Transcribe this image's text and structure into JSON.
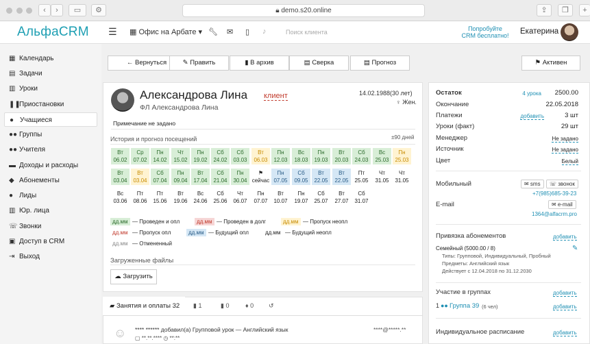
{
  "browser": {
    "url": "demo.s20.online",
    "back": "‹",
    "fwd": "›"
  },
  "topbar": {
    "logo": "АльфаCRM",
    "branch": "Офис на Арбате",
    "search_placeholder": "Поиск клиента",
    "promo": "Попробуйте CRM бесплатно!",
    "user": "Екатерина"
  },
  "sidebar": {
    "items": [
      {
        "icon": "calendar-icon",
        "glyph": "▦",
        "label": "Календарь"
      },
      {
        "icon": "tasks-icon",
        "glyph": "▤",
        "label": "Задачи"
      },
      {
        "icon": "lessons-icon",
        "glyph": "▥",
        "label": "Уроки"
      },
      {
        "icon": "pause-icon",
        "glyph": "❚❚",
        "label": "Приостановки"
      },
      {
        "icon": "user-icon",
        "glyph": "●",
        "label": "Учащиеся"
      },
      {
        "icon": "groups-icon",
        "glyph": "●●",
        "label": "Группы"
      },
      {
        "icon": "teachers-icon",
        "glyph": "●●",
        "label": "Учителя"
      },
      {
        "icon": "money-icon",
        "glyph": "▬",
        "label": "Доходы и расходы"
      },
      {
        "icon": "subscription-icon",
        "glyph": "◆",
        "label": "Абонементы"
      },
      {
        "icon": "leads-icon",
        "glyph": "●",
        "label": "Лиды"
      },
      {
        "icon": "company-icon",
        "glyph": "▥",
        "label": "Юр. лица"
      },
      {
        "icon": "phone-icon",
        "glyph": "☏",
        "label": "Звонки"
      },
      {
        "icon": "lock-icon",
        "glyph": "▣",
        "label": "Доступ в CRM"
      },
      {
        "icon": "exit-icon",
        "glyph": "⇥",
        "label": "Выход"
      }
    ]
  },
  "toolbar": {
    "back": "← Вернуться",
    "edit": "✎ Править",
    "archive": "▮ В архив",
    "reconcile": "▤ Сверка",
    "forecast": "▤ Прогноз",
    "status": "⚑ Активен"
  },
  "client": {
    "name": "Александрова Лина",
    "tag": "клиент",
    "subtitle": "ФЛ Александрова Лина",
    "birthdate": "14.02.1988(30 лет)",
    "gender": "♀ Жен.",
    "note": "Примечание не задано"
  },
  "history": {
    "title": "История и прогноз посещений",
    "range": "±90 дней",
    "rows": [
      [
        {
          "d": "Вт",
          "v": "06.02",
          "c": "g"
        },
        {
          "d": "Ср",
          "v": "07.02",
          "c": "g"
        },
        {
          "d": "Пн",
          "v": "14.02",
          "c": "g"
        },
        {
          "d": "Чт",
          "v": "15.02",
          "c": "g"
        },
        {
          "d": "Пн",
          "v": "19.02",
          "c": "g"
        },
        {
          "d": "Сб",
          "v": "24.02",
          "c": "g"
        },
        {
          "d": "Сб",
          "v": "03.03",
          "c": "g"
        },
        {
          "d": "Вт",
          "v": "06.03",
          "c": "y"
        },
        {
          "d": "Пн",
          "v": "12.03",
          "c": "g"
        },
        {
          "d": "Вс",
          "v": "18.03",
          "c": "g"
        },
        {
          "d": "Пн",
          "v": "19.03",
          "c": "g"
        },
        {
          "d": "Вт",
          "v": "20.03",
          "c": "g"
        },
        {
          "d": "Сб",
          "v": "24.03",
          "c": "g"
        },
        {
          "d": "Вс",
          "v": "25.03",
          "c": "g"
        },
        {
          "d": "Пн",
          "v": "25.03",
          "c": "y"
        }
      ],
      [
        {
          "d": "Вт",
          "v": "03.04",
          "c": "g"
        },
        {
          "d": "Вт",
          "v": "03.04",
          "c": "y"
        },
        {
          "d": "Сб",
          "v": "07.04",
          "c": "g"
        },
        {
          "d": "Пн",
          "v": "09.04",
          "c": "g"
        },
        {
          "d": "Вт",
          "v": "17.04",
          "c": "g"
        },
        {
          "d": "Сб",
          "v": "21.04",
          "c": "g"
        },
        {
          "d": "Пн",
          "v": "30.04",
          "c": "g"
        },
        {
          "d": "⚑",
          "v": "сейчас",
          "c": "w"
        },
        {
          "d": "Пн",
          "v": "07.05",
          "c": "b"
        },
        {
          "d": "Сб",
          "v": "09.05",
          "c": "b"
        },
        {
          "d": "Вт",
          "v": "22.05",
          "c": "b"
        },
        {
          "d": "Вт",
          "v": "22.05",
          "c": "b"
        },
        {
          "d": "Пт",
          "v": "25.05",
          "c": "w"
        },
        {
          "d": "Чт",
          "v": "31.05",
          "c": "w"
        },
        {
          "d": "Чт",
          "v": "31.05",
          "c": "w"
        }
      ],
      [
        {
          "d": "Вс",
          "v": "03.06",
          "c": "w"
        },
        {
          "d": "Пт",
          "v": "08.06",
          "c": "w"
        },
        {
          "d": "Пт",
          "v": "15.06",
          "c": "w"
        },
        {
          "d": "Вт",
          "v": "19.06",
          "c": "w"
        },
        {
          "d": "Вс",
          "v": "24.06",
          "c": "w"
        },
        {
          "d": "Сб",
          "v": "25.06",
          "c": "w"
        },
        {
          "d": "Чт",
          "v": "06.07",
          "c": "w"
        },
        {
          "d": "Пн",
          "v": "07.07",
          "c": "w"
        },
        {
          "d": "Вт",
          "v": "10.07",
          "c": "w"
        },
        {
          "d": "Пн",
          "v": "19.07",
          "c": "w"
        },
        {
          "d": "Сб",
          "v": "25.07",
          "c": "w"
        },
        {
          "d": "Вт",
          "v": "27.07",
          "c": "w"
        },
        {
          "d": "Сб",
          "v": "31.07",
          "c": "w"
        }
      ]
    ],
    "legend": [
      {
        "tag": "дд.мм",
        "text": "— Проведен и опл",
        "color": "#2b6a2b",
        "bg": "#d8eed7"
      },
      {
        "tag": "дд.мм",
        "text": "— Проведен в долг",
        "color": "#c0392b",
        "bg": "#f6d6d6"
      },
      {
        "tag": "дд.мм",
        "text": "— Пропуск неопл",
        "color": "#c78b00",
        "bg": "#fff3d1"
      },
      {
        "tag": "дд.мм",
        "text": "— Пропуск опл",
        "color": "#c0392b",
        "bg": "#fff"
      },
      {
        "tag": "дд.мм",
        "text": "— Будущий опл",
        "color": "#285b86",
        "bg": "#d5e7f5"
      },
      {
        "tag": "дд.мм",
        "text": "— Будущий неопл",
        "color": "#222",
        "bg": "#fff"
      },
      {
        "tag": "дд.мм",
        "text": "— Отмененный",
        "color": "#888",
        "bg": "#fff"
      }
    ],
    "files_title": "Загруженные файлы",
    "upload": "☁ Загрузить"
  },
  "tabs": {
    "lessons": "▰ Занятия и оплаты 32",
    "t2": "▮ 1",
    "t3": "▮ 0",
    "t4": "♦ 0",
    "t5": "↺"
  },
  "feed": {
    "line1": "**** ****** добавил(а) Групповой урок — Английский язык",
    "line2": "▢ **.**.****   ◷ **:**",
    "right": "****@*****.**"
  },
  "balance": {
    "rows": [
      {
        "label": "Остаток",
        "link": "4 урока",
        "value": "2500.00"
      },
      {
        "label": "Окончание",
        "link": "",
        "value": "22.05.2018"
      },
      {
        "label": "Платежи",
        "link": "добавить",
        "value": "3 шт"
      },
      {
        "label": "Уроки (факт)",
        "link": "",
        "value": "29 шт"
      },
      {
        "label": "Менеджер",
        "link": "",
        "value": "Не задано"
      },
      {
        "label": "Источник",
        "link": "",
        "value": "Не задано"
      },
      {
        "label": "Цвет",
        "link": "",
        "value": "Белый"
      }
    ],
    "mobile_label": "Мобильный",
    "sms": "✉ sms",
    "call": "☏ звонок",
    "phone": "+7(985)685-39-23",
    "email_label": "E-mail",
    "email_btn": "✉ e-mail",
    "email": "1364@alfacrm.pro",
    "subs_title": "Привязка абонементов",
    "subs_add": "добавить",
    "sub_name": "Семейный (5000.00 / 8)",
    "sub_types": "Типы: Групповой, Индивидуальный, Пробный",
    "sub_subjects": "Предметы: Английский язык",
    "sub_valid": "Действует с 12.04.2018 по 31.12.2030",
    "groups_title": "Участие в группах",
    "groups_add": "добавить",
    "group_count": "1",
    "group_name": "Группа 39",
    "group_people": "(6 чел)",
    "group_edit": "добавить",
    "schedule_title": "Индивидуальное расписание",
    "schedule_add": "добавить"
  }
}
